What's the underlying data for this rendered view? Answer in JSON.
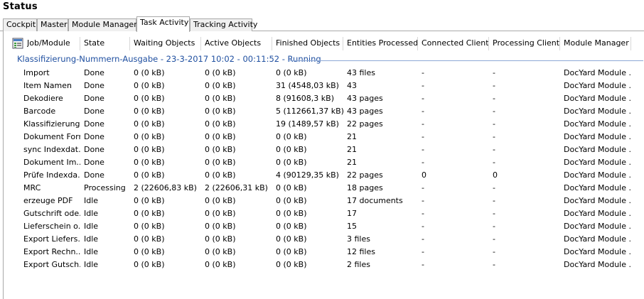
{
  "window": {
    "title": "Status"
  },
  "tabs": [
    {
      "label": "Cockpit",
      "active": false
    },
    {
      "label": "Master",
      "active": false
    },
    {
      "label": "Module Managers",
      "active": false
    },
    {
      "label": "Task Activity",
      "active": true
    },
    {
      "label": "Tracking Activity",
      "active": false
    }
  ],
  "table": {
    "headers": [
      "Job/Module",
      "State",
      "Waiting Objects",
      "Active Objects",
      "Finished Objects",
      "Entities Processed",
      "Connected Clients",
      "Processing Clients",
      "Module Manager"
    ],
    "group_label": "Klassifizierung-Nummern-Ausgabe - 23-3-2017 10:02 - 00:11:52 - Running",
    "rows": [
      [
        "Import",
        "Done",
        "0 (0 kB)",
        "0 (0 kB)",
        "0 (0 kB)",
        "43 files",
        "-",
        "-",
        "DocYard Module ..."
      ],
      [
        "Item Namen",
        "Done",
        "0 (0 kB)",
        "0 (0 kB)",
        "31 (4548,03 kB)",
        "43",
        "-",
        "-",
        "DocYard Module ..."
      ],
      [
        "Dekodiere",
        "Done",
        "0 (0 kB)",
        "0 (0 kB)",
        "8 (91608,3 kB)",
        "43 pages",
        "-",
        "-",
        "DocYard Module ..."
      ],
      [
        "Barcode",
        "Done",
        "0 (0 kB)",
        "0 (0 kB)",
        "5 (112661,37 kB)",
        "43 pages",
        "-",
        "-",
        "DocYard Module ..."
      ],
      [
        "Klassifizierung",
        "Done",
        "0 (0 kB)",
        "0 (0 kB)",
        "19 (1489,57 kB)",
        "22 pages",
        "-",
        "-",
        "DocYard Module ..."
      ],
      [
        "Dokument Form",
        "Done",
        "0 (0 kB)",
        "0 (0 kB)",
        "0 (0 kB)",
        "21",
        "-",
        "-",
        "DocYard Module ..."
      ],
      [
        "sync Indexdat...",
        "Done",
        "0 (0 kB)",
        "0 (0 kB)",
        "0 (0 kB)",
        "21",
        "-",
        "-",
        "DocYard Module ..."
      ],
      [
        "Dokument Im...",
        "Done",
        "0 (0 kB)",
        "0 (0 kB)",
        "0 (0 kB)",
        "21",
        "-",
        "-",
        "DocYard Module ..."
      ],
      [
        "Prüfe Indexda...",
        "Done",
        "0 (0 kB)",
        "0 (0 kB)",
        "4 (90129,35 kB)",
        "22 pages",
        "0",
        "0",
        "DocYard Module ..."
      ],
      [
        "MRC",
        "Processing",
        "2 (22606,83 kB)",
        "2 (22606,31 kB)",
        "0 (0 kB)",
        "18 pages",
        "-",
        "-",
        "DocYard Module ..."
      ],
      [
        "erzeuge PDF",
        "Idle",
        "0 (0 kB)",
        "0 (0 kB)",
        "0 (0 kB)",
        "17 documents",
        "-",
        "-",
        "DocYard Module ..."
      ],
      [
        "Gutschrift ode...",
        "Idle",
        "0 (0 kB)",
        "0 (0 kB)",
        "0 (0 kB)",
        "17",
        "-",
        "-",
        "DocYard Module ..."
      ],
      [
        "Lieferschein o...",
        "Idle",
        "0 (0 kB)",
        "0 (0 kB)",
        "0 (0 kB)",
        "15",
        "-",
        "-",
        "DocYard Module ..."
      ],
      [
        "Export Liefers...",
        "Idle",
        "0 (0 kB)",
        "0 (0 kB)",
        "0 (0 kB)",
        "3 files",
        "-",
        "-",
        "DocYard Module ..."
      ],
      [
        "Export Rechn...",
        "Idle",
        "0 (0 kB)",
        "0 (0 kB)",
        "0 (0 kB)",
        "12 files",
        "-",
        "-",
        "DocYard Module ..."
      ],
      [
        "Export Gutsch...",
        "Idle",
        "0 (0 kB)",
        "0 (0 kB)",
        "0 (0 kB)",
        "2 files",
        "-",
        "-",
        "DocYard Module ..."
      ]
    ]
  },
  "icons": {
    "header_icon": "job-module-grid-icon"
  },
  "colors": {
    "group_text": "#1f4fa0",
    "group_line": "#8ea9d6",
    "tab_border": "#a9a9a9"
  }
}
